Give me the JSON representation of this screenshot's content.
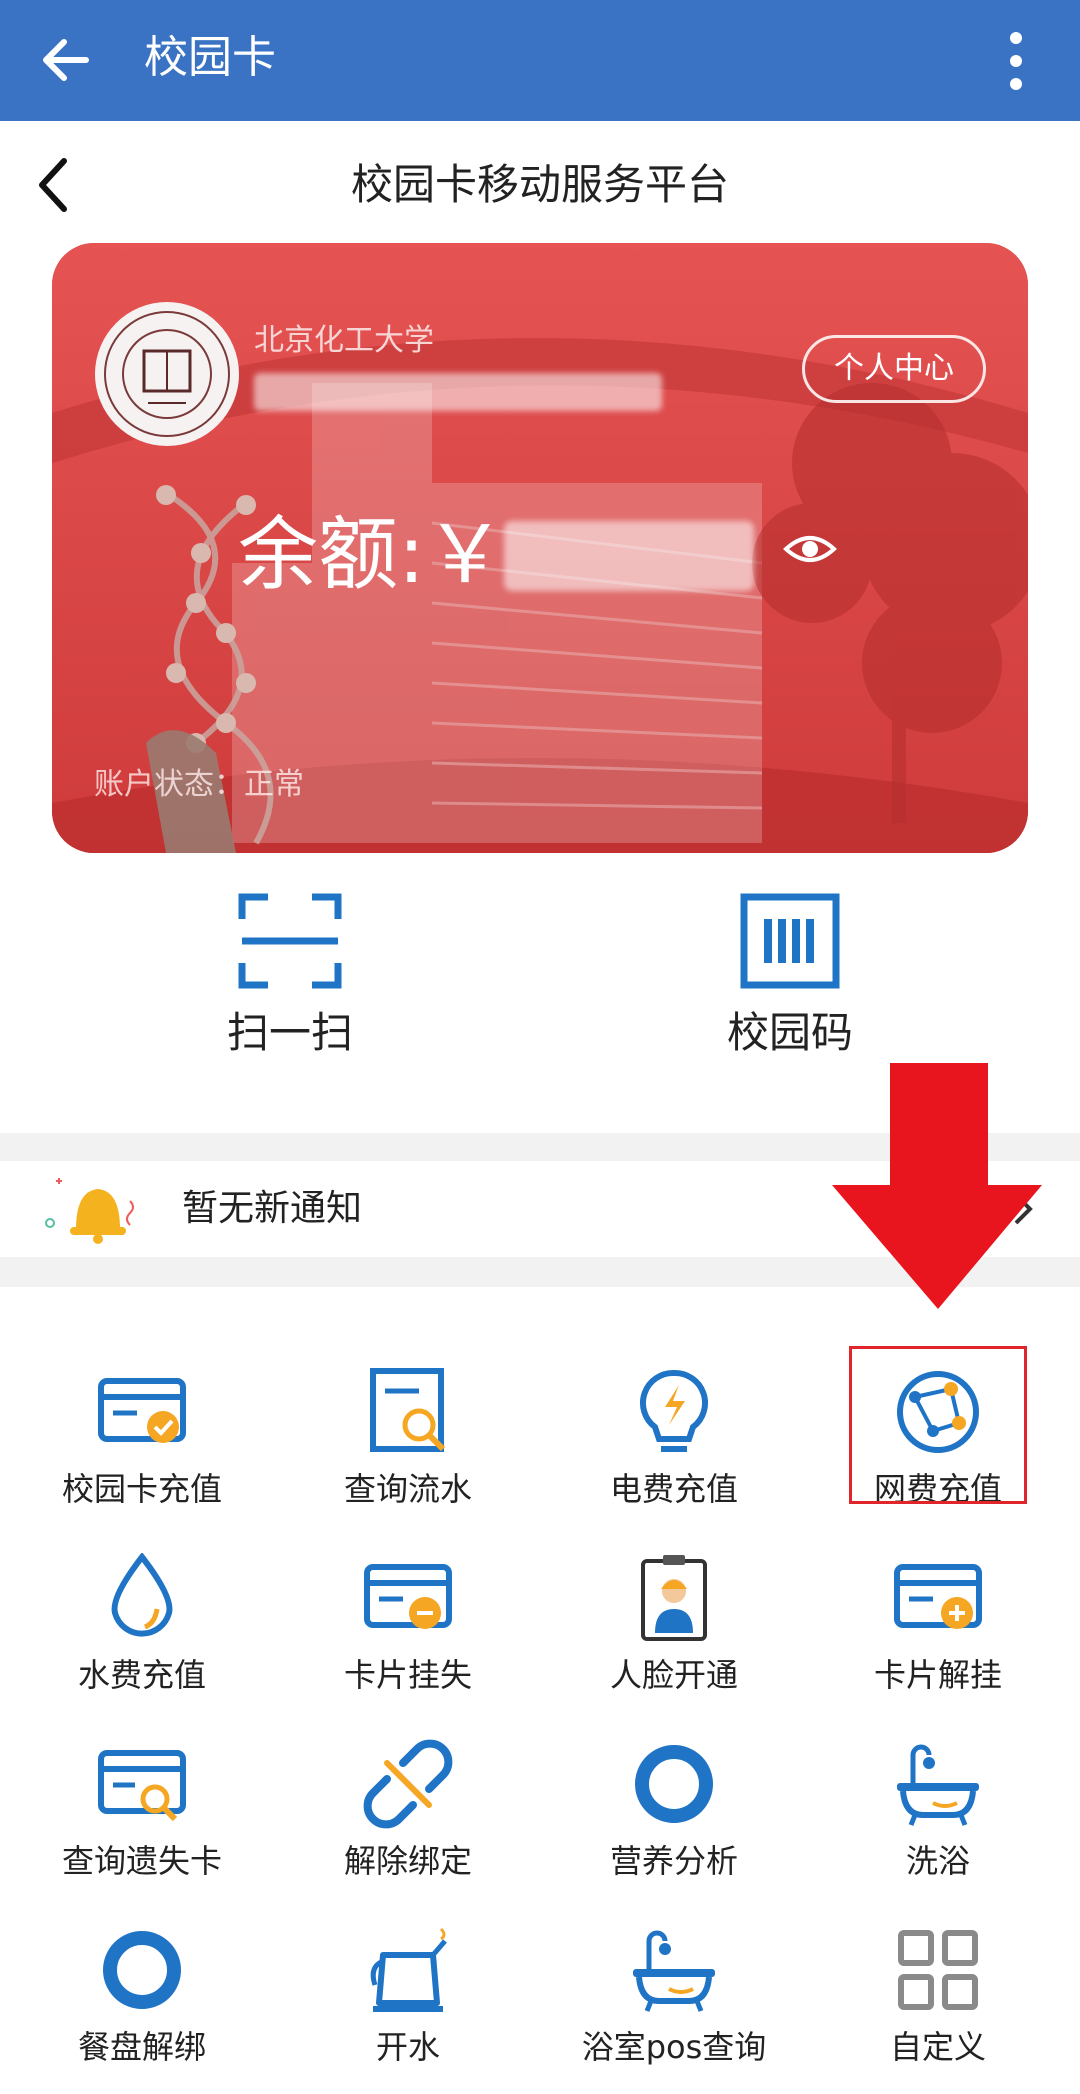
{
  "appbar": {
    "title": "校园卡",
    "back_icon": "arrow-left-icon",
    "menu_icon": "more-vertical-icon"
  },
  "page": {
    "title": "校园卡移动服务平台",
    "back_icon": "chevron-left-icon"
  },
  "card": {
    "school_name": "北京化工大学",
    "personal_center": "个人中心",
    "balance_label": "余额:￥",
    "status_label": "账户状态：正常",
    "accent_color": "#d43b3b"
  },
  "quick_actions": [
    {
      "label": "扫一扫",
      "icon": "scan-icon"
    },
    {
      "label": "校园码",
      "icon": "barcode-icon"
    }
  ],
  "notice": {
    "text": "暂无新通知",
    "icon": "bell-icon"
  },
  "services": [
    {
      "label": "校园卡充值",
      "icon": "card-recharge-icon"
    },
    {
      "label": "查询流水",
      "icon": "query-transactions-icon"
    },
    {
      "label": "电费充值",
      "icon": "electricity-icon"
    },
    {
      "label": "网费充值",
      "icon": "network-icon"
    },
    {
      "label": "水费充值",
      "icon": "water-drop-icon"
    },
    {
      "label": "卡片挂失",
      "icon": "card-lost-icon"
    },
    {
      "label": "人脸开通",
      "icon": "face-id-icon"
    },
    {
      "label": "卡片解挂",
      "icon": "card-unlock-icon"
    },
    {
      "label": "查询遗失卡",
      "icon": "lost-card-search-icon"
    },
    {
      "label": "解除绑定",
      "icon": "unbind-icon"
    },
    {
      "label": "营养分析",
      "icon": "ring-icon"
    },
    {
      "label": "洗浴",
      "icon": "bathtub-icon"
    },
    {
      "label": "餐盘解绑",
      "icon": "ring-icon"
    },
    {
      "label": "开水",
      "icon": "kettle-icon"
    },
    {
      "label": "浴室pos查询",
      "icon": "bathtub-icon"
    },
    {
      "label": "自定义",
      "icon": "grid-icon"
    }
  ],
  "colors": {
    "primary_blue": "#1f74c6",
    "orange": "#f5a623",
    "appbar": "#3a73c4",
    "highlight_red": "#e0262b"
  }
}
